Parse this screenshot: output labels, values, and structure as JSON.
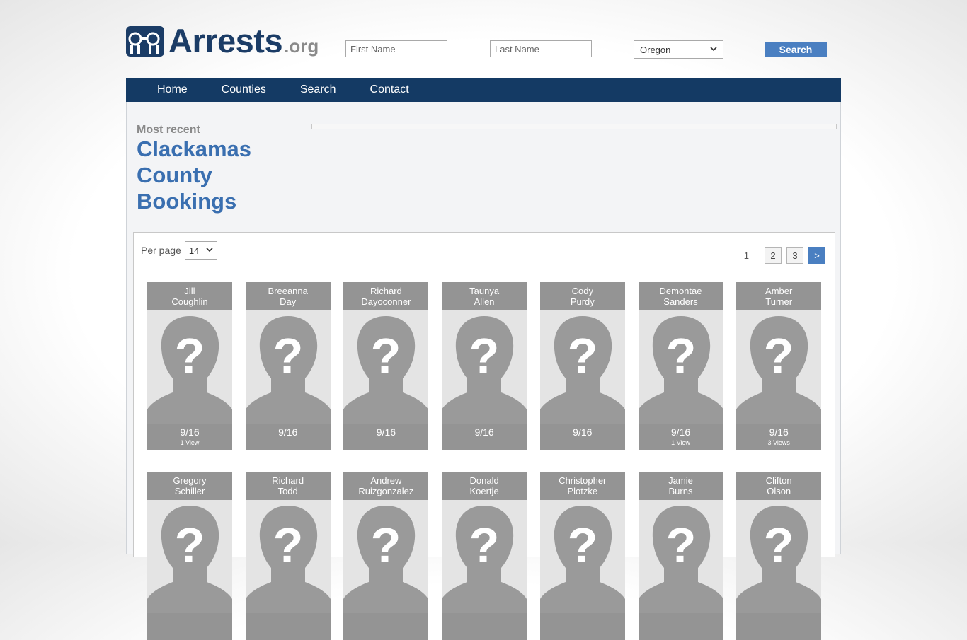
{
  "header": {
    "logo_main": "Arrests",
    "logo_suffix": ".org",
    "first_name_placeholder": "First Name",
    "last_name_placeholder": "Last Name",
    "state_selected": "Oregon",
    "search_label": "Search"
  },
  "nav": {
    "items": [
      "Home",
      "Counties",
      "Search",
      "Contact"
    ]
  },
  "page": {
    "most_recent": "Most recent",
    "title_lines": [
      "Clackamas",
      "County",
      "Bookings"
    ]
  },
  "list": {
    "per_page_label": "Per page",
    "per_page_value": "14",
    "pager": {
      "current": "1",
      "pages": [
        "2",
        "3"
      ],
      "next": ">"
    },
    "cards": [
      {
        "first": "Jill",
        "last": "Coughlin",
        "date": "9/16",
        "views": "1 View"
      },
      {
        "first": "Breeanna",
        "last": "Day",
        "date": "9/16",
        "views": ""
      },
      {
        "first": "Richard",
        "last": "Dayoconner",
        "date": "9/16",
        "views": ""
      },
      {
        "first": "Taunya",
        "last": "Allen",
        "date": "9/16",
        "views": ""
      },
      {
        "first": "Cody",
        "last": "Purdy",
        "date": "9/16",
        "views": ""
      },
      {
        "first": "Demontae",
        "last": "Sanders",
        "date": "9/16",
        "views": "1 View"
      },
      {
        "first": "Amber",
        "last": "Turner",
        "date": "9/16",
        "views": "3 Views"
      },
      {
        "first": "Gregory",
        "last": "Schiller",
        "date": "",
        "views": ""
      },
      {
        "first": "Richard",
        "last": "Todd",
        "date": "",
        "views": ""
      },
      {
        "first": "Andrew",
        "last": "Ruizgonzalez",
        "date": "",
        "views": ""
      },
      {
        "first": "Donald",
        "last": "Koertje",
        "date": "",
        "views": ""
      },
      {
        "first": "Christopher",
        "last": "Plotzke",
        "date": "",
        "views": ""
      },
      {
        "first": "Jamie",
        "last": "Burns",
        "date": "",
        "views": ""
      },
      {
        "first": "Clifton",
        "last": "Olson",
        "date": "",
        "views": ""
      }
    ]
  }
}
